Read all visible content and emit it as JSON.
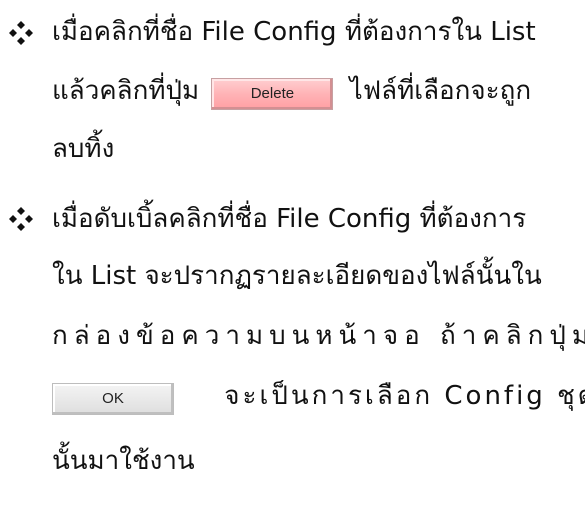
{
  "items": [
    {
      "bullet_icon": "four-diamond-bullet",
      "lines": [
        "เมื่อคลิกที่ชื่อ File Config ที่ต้องการใน List",
        {
          "before": "แล้วคลิกที่ปุ่ม",
          "button_label": "Delete",
          "after": "ไฟล์ที่เลือกจะถูก"
        },
        "ลบทิ้ง"
      ]
    },
    {
      "bullet_icon": "four-diamond-bullet",
      "lines": [
        "เมื่อดับเบิ้ลคลิกที่ชื่อ File Config ที่ต้องการ",
        "ใน List จะปรากฏรายละเอียดของไฟล์นั้นใน",
        "กล่องข้อความบนหน้าจอ ถ้าคลิกปุ่ม",
        {
          "button_label": "OK",
          "after": "จะเป็นการเลือก Config ชุด"
        },
        "นั้นมาใช้งาน"
      ]
    }
  ],
  "colors": {
    "delete_button": "#ffb3b6",
    "ok_button": "#e7e7e7",
    "text": "#111111"
  }
}
